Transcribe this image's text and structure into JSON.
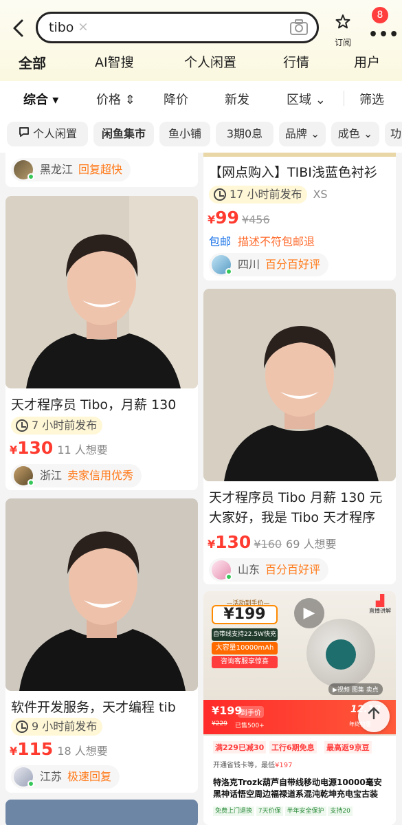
{
  "header": {
    "search_query": "tibo",
    "subscribe_label": "订阅",
    "notification_count": "8"
  },
  "tabs": [
    "全部",
    "AI智搜",
    "个人闲置",
    "行情",
    "用户"
  ],
  "sort": [
    "综合",
    "价格",
    "降价",
    "新发",
    "区域",
    "筛选"
  ],
  "chips": [
    "个人闲置",
    "闲鱼集市",
    "鱼小铺",
    "3期0息",
    "品牌",
    "成色",
    "功"
  ],
  "left_col": {
    "seller0": {
      "location": "黑龙江",
      "tag": "回复超快"
    },
    "item1": {
      "title": "天才程序员 Tibo，月薪 130",
      "time": "7 小时前发布",
      "price": "130",
      "want": "11 人想要",
      "location": "浙江",
      "tag": "卖家信用优秀"
    },
    "item2": {
      "title": "软件开发服务，天才编程 tib",
      "time": "9 小时前发布",
      "price": "115",
      "want": "18 人想要",
      "location": "江苏",
      "tag": "极速回复"
    }
  },
  "right_col": {
    "item0": {
      "title": "【网点购入】TIBI浅蓝色衬衫",
      "time": "17 小时前发布",
      "size": "XS",
      "price": "99",
      "old_price": "¥456",
      "tag_free_ship": "包邮",
      "tag_desc": "描述不符包邮退",
      "location": "四川",
      "tag": "百分百好评"
    },
    "item1": {
      "title": "天才程序员 Tibo 月薪 130 元",
      "title2": "大家好，我是 Tibo 天才程序",
      "price": "130",
      "old_price": "¥160",
      "want": "69 人想要",
      "location": "山东",
      "tag": "百分百好评"
    },
    "ad": {
      "activity": "—活动到手价—",
      "big_price": "199",
      "feat1": "自带线支持22.5W快充",
      "feat2": "大容量10000mAh",
      "feat3": "咨询客服享惊喜",
      "live": "直播讲解",
      "video": "视频",
      "photos": "图集",
      "selling": "卖点",
      "deal_price": "¥199",
      "deal_label": "到手价",
      "orig": "¥229",
      "sold": "已售500+",
      "date": "12.12",
      "date_sub": "年终特惠",
      "promo1": "满229已减30",
      "promo2": "工行6期免息",
      "promo3": "最高返9京豆",
      "card_label": "开通省钱卡等，最低",
      "card_price": "¥197",
      "title": "特洛克Trozk葫芦自带线移动电源10000毫安黑神话悟空周边福禄道系混沌乾坤充电宝古装",
      "svc1": "免费上门退换",
      "svc2": "7天价保",
      "svc3": "半年安全保护",
      "svc4": "支持20"
    }
  },
  "colors": {
    "accent_yellow": "#ffd91a",
    "price_red": "#ff3b30",
    "tag_orange": "#ff7a1a",
    "link_blue": "#1a73e8"
  }
}
